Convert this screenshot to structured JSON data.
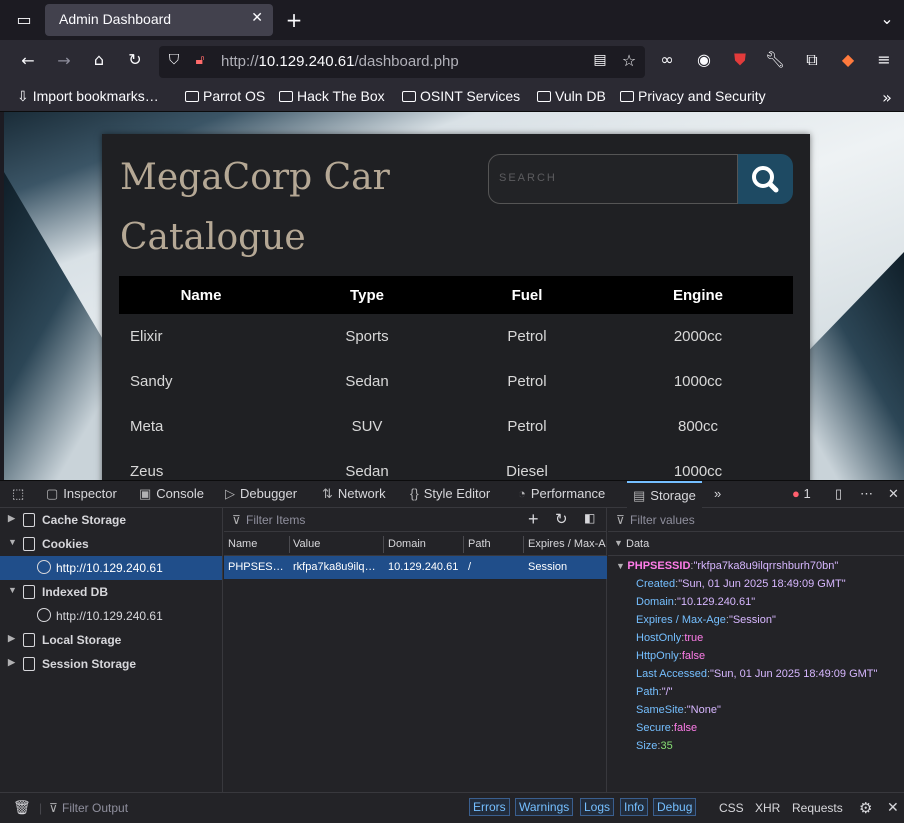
{
  "browser": {
    "tab_title": "Admin Dashboard",
    "url_scheme": "http://",
    "url_host": "10.129.240.61",
    "url_path": "/dashboard.php",
    "bookmarks": [
      "Import bookmarks…",
      "Parrot OS",
      "Hack The Box",
      "OSINT Services",
      "Vuln DB",
      "Privacy and Security"
    ]
  },
  "site": {
    "title": "MegaCorp Car Catalogue",
    "search_placeholder": "SEARCH",
    "columns": [
      "Name",
      "Type",
      "Fuel",
      "Engine"
    ],
    "rows": [
      [
        "Elixir",
        "Sports",
        "Petrol",
        "2000cc"
      ],
      [
        "Sandy",
        "Sedan",
        "Petrol",
        "1000cc"
      ],
      [
        "Meta",
        "SUV",
        "Petrol",
        "800cc"
      ],
      [
        "Zeus",
        "Sedan",
        "Diesel",
        "1000cc"
      ]
    ]
  },
  "devtools": {
    "tabs": [
      "Inspector",
      "Console",
      "Debugger",
      "Network",
      "Style Editor",
      "Performance",
      "Storage"
    ],
    "active_tab": "Storage",
    "error_count": "1",
    "tree": {
      "cache_storage": "Cache Storage",
      "cookies": "Cookies",
      "cookies_host": "http://10.129.240.61",
      "indexed_db": "Indexed DB",
      "indexed_db_host": "http://10.129.240.61",
      "local_storage": "Local Storage",
      "session_storage": "Session Storage"
    },
    "filter_items": "Filter Items",
    "filter_values": "Filter values",
    "cookie_columns": [
      "Name",
      "Value",
      "Domain",
      "Path",
      "Expires / Max-Age"
    ],
    "cookie_row": [
      "PHPSESSID",
      "rkfpa7ka8u9ilqrrshburh70bn",
      "10.129.240.61",
      "/",
      "Session"
    ],
    "data_header": "Data",
    "data": {
      "name_key": "PHPSESSID",
      "name_val": "\"rkfpa7ka8u9ilqrrshburh70bn\"",
      "created": "\"Sun, 01 Jun 2025 18:49:09 GMT\"",
      "domain": "\"10.129.240.61\"",
      "expires": "\"Session\"",
      "hostonly": "true",
      "httponly": "false",
      "last_accessed": "\"Sun, 01 Jun 2025 18:49:09 GMT\"",
      "path": "\"/\"",
      "samesite": "\"None\"",
      "secure": "false",
      "size": "35"
    },
    "console": {
      "filter_output": "Filter Output",
      "filters": [
        "Errors",
        "Warnings",
        "Logs",
        "Info",
        "Debug"
      ],
      "extra": [
        "CSS",
        "XHR",
        "Requests"
      ]
    }
  },
  "colors": {
    "accent": "#75bfff",
    "selection": "#204e8a",
    "site_title": "#b5a895",
    "search_button": "#1e4a63"
  }
}
